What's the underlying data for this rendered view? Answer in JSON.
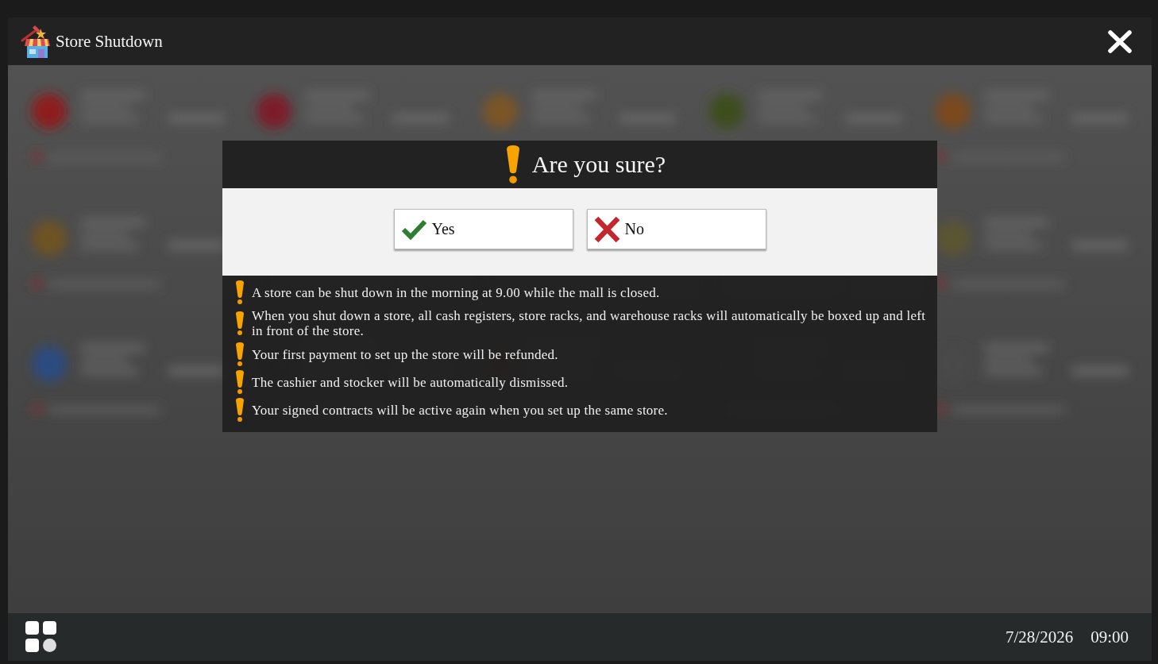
{
  "window": {
    "title": "Store Shutdown"
  },
  "dialog": {
    "title": "Are you sure?",
    "buttons": [
      {
        "kind": "confirm",
        "label": "Yes"
      },
      {
        "kind": "cancel",
        "label": "No"
      }
    ],
    "notes": [
      "A store can be shut down in the morning at 9.00 while the mall is closed.",
      "When you shut down a store, all cash registers, store racks, and warehouse racks will automatically be boxed up and left in front of the store.",
      "Your first payment to set up the store will be refunded.",
      "The cashier and stocker will be automatically dismissed.",
      "Your signed contracts will be active again when you set up the same store."
    ]
  },
  "taskbar": {
    "date": "7/28/2026",
    "time": "09:00"
  }
}
